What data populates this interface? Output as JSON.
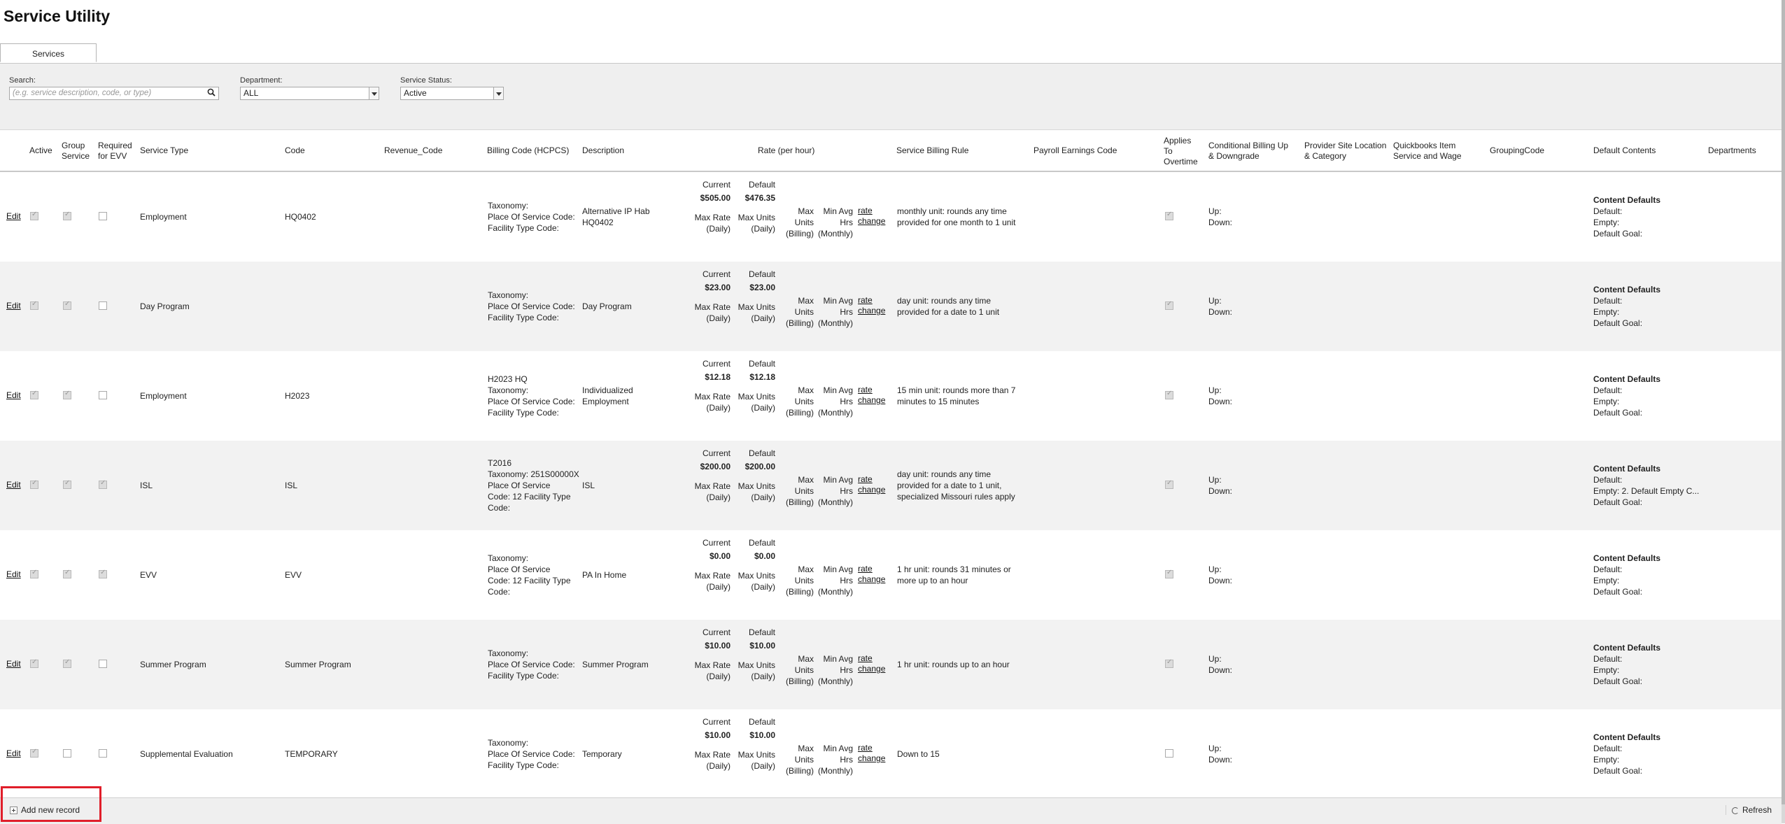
{
  "page_title": "Service Utility",
  "tabs": [
    {
      "label": "Services"
    }
  ],
  "filters": {
    "search_label": "Search:",
    "search_placeholder": "(e.g. service description, code, or type)",
    "department_label": "Department:",
    "department_value": "ALL",
    "status_label": "Service Status:",
    "status_value": "Active"
  },
  "columns": {
    "active": "Active",
    "group_service": "Group Service",
    "required_evv": "Required for EVV",
    "service_type": "Service Type",
    "code": "Code",
    "revenue_code": "Revenue_Code",
    "billing_code": "Billing Code (HCPCS)",
    "description": "Description",
    "rate": "Rate (per hour)",
    "billing_rule": "Service Billing Rule",
    "payroll_code": "Payroll Earnings Code",
    "applies_overtime": "Applies To Overtime",
    "conditional_billing": "Conditional Billing Up & Downgrade",
    "provider_site": "Provider Site Location & Category",
    "quickbooks": "Quickbooks Item Service and Wage",
    "grouping_code": "GroupingCode",
    "default_contents": "Default Contents",
    "departments": "Departments"
  },
  "labels": {
    "edit": "Edit",
    "current": "Current",
    "default": "Default",
    "max_rate": "Max Rate",
    "daily": "(Daily)",
    "max_units": "Max Units",
    "max": "Max",
    "units": "Units",
    "billing": "(Billing)",
    "min_avg": "Min Avg",
    "hrs": "Hrs",
    "monthly": "(Monthly)",
    "rate": "rate",
    "change": "change",
    "up": "Up:",
    "down": "Down:",
    "content_defaults": "Content Defaults",
    "cd_default": "Default:",
    "cd_goal": "Default Goal:"
  },
  "rows": [
    {
      "active": true,
      "group": true,
      "evv": false,
      "type": "Employment",
      "code": "HQ0402",
      "billing": [
        "Taxonomy:",
        "Place Of Service Code:",
        "Facility Type Code:"
      ],
      "description": [
        "Alternative IP Hab",
        "HQ0402"
      ],
      "current": "$505.00",
      "default": "$476.35",
      "rule": [
        "monthly unit: rounds any time",
        "provided for one month to 1 unit"
      ],
      "overtime": true,
      "empty": "Empty:"
    },
    {
      "active": true,
      "group": true,
      "evv": false,
      "type": "Day Program",
      "code": "",
      "billing": [
        "Taxonomy:",
        "Place Of Service Code:",
        "Facility Type Code:"
      ],
      "description": [
        "Day Program"
      ],
      "current": "$23.00",
      "default": "$23.00",
      "rule": [
        "day unit: rounds any time",
        "provided for a date to 1 unit"
      ],
      "overtime": true,
      "empty": "Empty:"
    },
    {
      "active": true,
      "group": true,
      "evv": false,
      "type": "Employment",
      "code": "H2023",
      "billing": [
        "H2023 HQ",
        "Taxonomy:",
        "Place Of Service Code:",
        "Facility Type Code:"
      ],
      "description": [
        "Individualized",
        "Employment"
      ],
      "current": "$12.18",
      "default": "$12.18",
      "rule": [
        "15 min unit: rounds more than 7",
        "minutes to 15 minutes"
      ],
      "overtime": true,
      "empty": "Empty:"
    },
    {
      "active": true,
      "group": true,
      "evv": true,
      "type": "ISL",
      "code": "ISL",
      "billing": [
        "T2016",
        "Taxonomy: 251S00000X",
        "Place Of Service",
        "Code: 12 Facility Type",
        "Code:"
      ],
      "description": [
        "ISL"
      ],
      "current": "$200.00",
      "default": "$200.00",
      "rule": [
        "day unit: rounds any time",
        "provided for a date to 1 unit,",
        "specialized Missouri rules apply"
      ],
      "overtime": true,
      "empty": "Empty: 2. Default Empty C..."
    },
    {
      "active": true,
      "group": true,
      "evv": true,
      "type": "EVV",
      "code": "EVV",
      "billing": [
        "Taxonomy:",
        "Place Of Service",
        "Code: 12 Facility Type",
        "Code:"
      ],
      "description": [
        "PA In Home"
      ],
      "current": "$0.00",
      "default": "$0.00",
      "rule": [
        "1 hr unit: rounds 31 minutes or",
        "more up to an hour"
      ],
      "overtime": true,
      "empty": "Empty:"
    },
    {
      "active": true,
      "group": true,
      "evv": false,
      "type": "Summer Program",
      "code": "Summer Program",
      "billing": [
        "Taxonomy:",
        "Place Of Service Code:",
        "Facility Type Code:"
      ],
      "description": [
        "Summer Program"
      ],
      "current": "$10.00",
      "default": "$10.00",
      "rule": [
        "1 hr unit: rounds up to an hour"
      ],
      "overtime": true,
      "empty": "Empty:"
    },
    {
      "active": true,
      "group": false,
      "evv": false,
      "type": "Supplemental Evaluation",
      "code": "TEMPORARY",
      "billing": [
        "Taxonomy:",
        "Place Of Service Code:",
        "Facility Type Code:"
      ],
      "description": [
        "Temporary"
      ],
      "current": "$10.00",
      "default": "$10.00",
      "rule": [
        "Down to 15"
      ],
      "overtime": false,
      "empty": "Empty:"
    }
  ],
  "footer": {
    "add_label": "Add new record",
    "refresh_label": "Refresh"
  }
}
